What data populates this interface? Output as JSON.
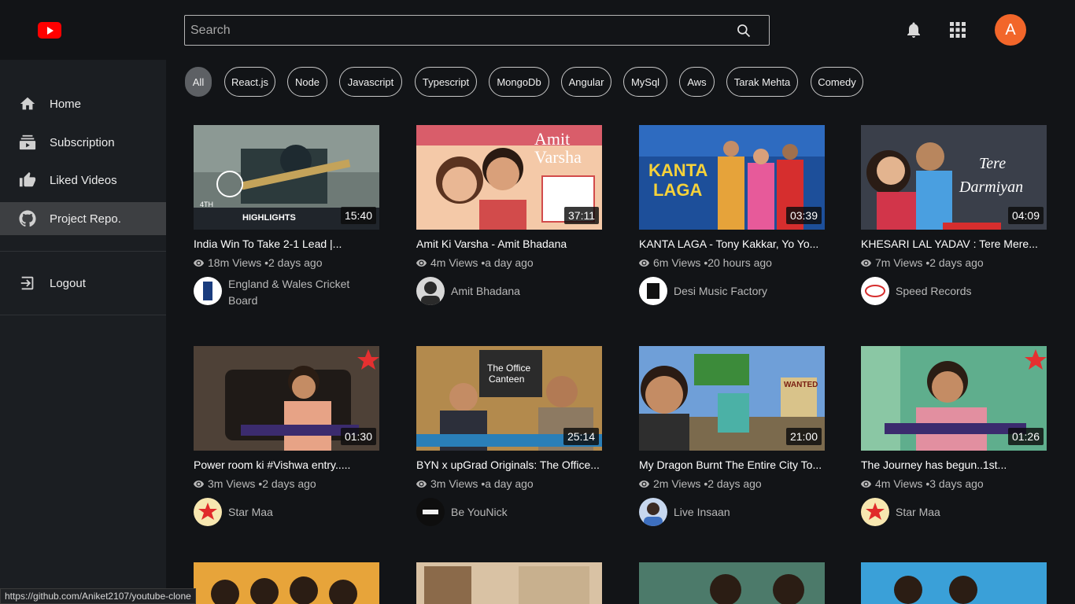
{
  "header": {
    "search_placeholder": "Search",
    "avatar_letter": "A"
  },
  "sidebar": {
    "items": [
      {
        "label": "Home",
        "icon": "home-icon"
      },
      {
        "label": "Subscription",
        "icon": "subscription-icon"
      },
      {
        "label": "Liked Videos",
        "icon": "thumbs-up-icon"
      },
      {
        "label": "Project Repo.",
        "icon": "github-icon",
        "active": true
      },
      {
        "label": "Logout",
        "icon": "logout-icon"
      }
    ]
  },
  "chips": [
    "All",
    "React.js",
    "Node",
    "Javascript",
    "Typescript",
    "MongoDb",
    "Angular",
    "MySql",
    "Aws",
    "Tarak Mehta",
    "Comedy"
  ],
  "videos": [
    {
      "title": "India Win To Take 2-1 Lead |...",
      "views": "18m Views •2 days ago",
      "duration": "15:40",
      "channel": "England & Wales Cricket Board"
    },
    {
      "title": "Amit Ki Varsha - Amit Bhadana",
      "views": "4m Views •a day ago",
      "duration": "37:11",
      "channel": "Amit Bhadana"
    },
    {
      "title": "KANTA LAGA - Tony Kakkar, Yo Yo...",
      "views": "6m Views •20 hours ago",
      "duration": "03:39",
      "channel": "Desi Music Factory"
    },
    {
      "title": "KHESARI LAL YADAV : Tere Mere...",
      "views": "7m Views •2 days ago",
      "duration": "04:09",
      "channel": "Speed Records"
    },
    {
      "title": "Power room ki #Vishwa entry.....",
      "views": "3m Views •2 days ago",
      "duration": "01:30",
      "channel": "Star Maa"
    },
    {
      "title": "BYN x upGrad Originals: The Office...",
      "views": "3m Views •a day ago",
      "duration": "25:14",
      "channel": "Be YouNick"
    },
    {
      "title": "My Dragon Burnt The Entire City To...",
      "views": "2m Views •2 days ago",
      "duration": "21:00",
      "channel": "Live Insaan"
    },
    {
      "title": "The Journey has begun..1st...",
      "views": "4m Views •3 days ago",
      "duration": "01:26",
      "channel": "Star Maa"
    }
  ],
  "status_link": "https://github.com/Aniket2107/youtube-clone",
  "colors": {
    "background": "#121417",
    "sidebar": "#1b1e22",
    "brand": "#ff0000",
    "avatar": "#f2662a"
  }
}
